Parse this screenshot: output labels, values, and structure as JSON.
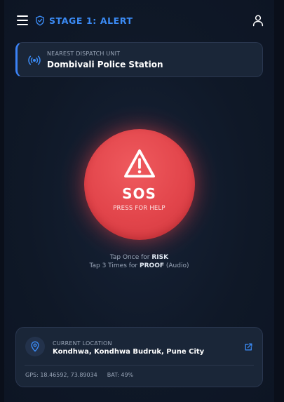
{
  "header": {
    "title": "STAGE 1: ALERT",
    "menu_icon": "hamburger-menu-icon",
    "stage_icon": "shield-check-icon",
    "profile_icon": "user-icon"
  },
  "dispatch": {
    "label": "NEAREST DISPATCH UNIT",
    "value": "Dombivali Police Station",
    "icon": "broadcast-icon"
  },
  "sos": {
    "title": "SOS",
    "subtitle": "PRESS FOR HELP",
    "icon": "warning-triangle-icon"
  },
  "instructions": {
    "line1_prefix": "Tap Once for",
    "line1_emph": "RISK",
    "line2_prefix": "Tap 3 Times for",
    "line2_emph": "PROOF",
    "line2_suffix": "(Audio)"
  },
  "location": {
    "label": "CURRENT LOCATION",
    "value": "Kondhwa, Kondhwa Budruk, Pune City",
    "gps": "GPS: 18.46592, 73.89034",
    "battery": "BAT: 49%",
    "icon": "map-pin-icon",
    "link_icon": "external-link-icon"
  },
  "colors": {
    "accent": "#3b8bf5",
    "sos_red": "#e2454b",
    "background": "#0e1626",
    "card": "#1a2638"
  }
}
